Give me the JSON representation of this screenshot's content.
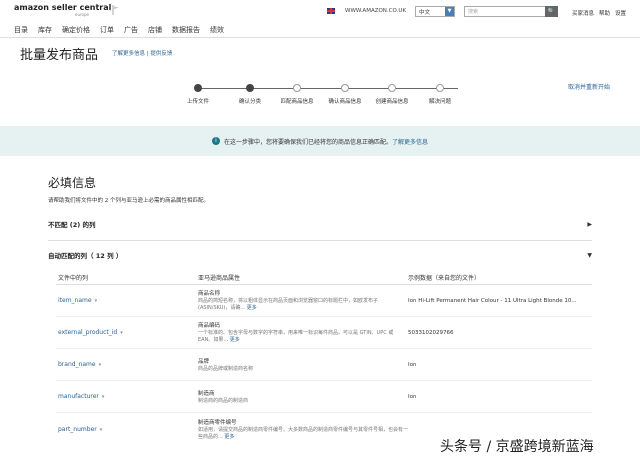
{
  "header": {
    "logo_main": "amazon seller central",
    "logo_sub": "europe",
    "site": "WWW.AMAZON.CO.UK",
    "language": "中文",
    "search_placeholder": "搜索",
    "search_button": "🔍",
    "links": [
      "买家消息",
      "帮助",
      "设置"
    ]
  },
  "nav": {
    "items": [
      "目录",
      "库存",
      "确定价格",
      "订单",
      "广告",
      "店铺",
      "数据报告",
      "绩效"
    ]
  },
  "title": {
    "text": "批量发布商品",
    "links": "了解更多信息 | 提供反馈"
  },
  "steps": [
    {
      "label": "上传文件",
      "done": true
    },
    {
      "label": "确认分类",
      "done": true
    },
    {
      "label": "匹配商品信息",
      "done": false
    },
    {
      "label": "确认商品信息",
      "done": false
    },
    {
      "label": "创建商品信息",
      "done": false
    },
    {
      "label": "解决问题",
      "done": false
    }
  ],
  "cancel": "取消并重新开始",
  "banner": {
    "text": "在这一步骤中，您将要确保我们已经将您的商品信息正确匹配。",
    "link": "了解更多信息"
  },
  "required": {
    "heading": "必填信息",
    "note": "请帮助我们将文件中的 2 个列与亚马逊上必需的商品属性相匹配。",
    "unmatched": "不匹配 (2) 的列",
    "matched": "自动匹配的列（ 12 列 ）"
  },
  "table": {
    "headers": [
      "文件中的列",
      "亚马逊商品属性",
      "示例数据（来自您的文件）"
    ],
    "more_label": "更多",
    "rows": [
      {
        "col": "item_name",
        "attr": "商品名称",
        "desc": "商品的简短名称，将以粗体显示在商品页面和浏览器窗口的标题栏中，如欧发布子 (ASIN/SKU)，请确...",
        "sample": "Ion Hi-Lift Permanent Hair Colour - 11 Ultra Light Blonde 10..."
      },
      {
        "col": "external_product_id",
        "attr": "商品编码",
        "desc": "一个标准的、包含字母与数字的字符串，用来唯一标识每件商品。可以是 GTIN、UPC 或 EAN。如果...",
        "sample": "5033102029766"
      },
      {
        "col": "brand_name",
        "attr": "品牌",
        "desc": "商品的品牌或制造商名称",
        "sample": "Ion"
      },
      {
        "col": "manufacturer",
        "attr": "制造商",
        "desc": "制造商的商品的制造商",
        "sample": "Ion"
      },
      {
        "col": "part_number",
        "attr": "制造商零件编号",
        "desc": "如适用，请提交商品的制造商零件编号。大多数商品的制造商零件编号与其零件号相，也会有一些商品的...",
        "sample": ""
      }
    ]
  },
  "watermark": "头条号 / 京盛跨境新蓝海"
}
